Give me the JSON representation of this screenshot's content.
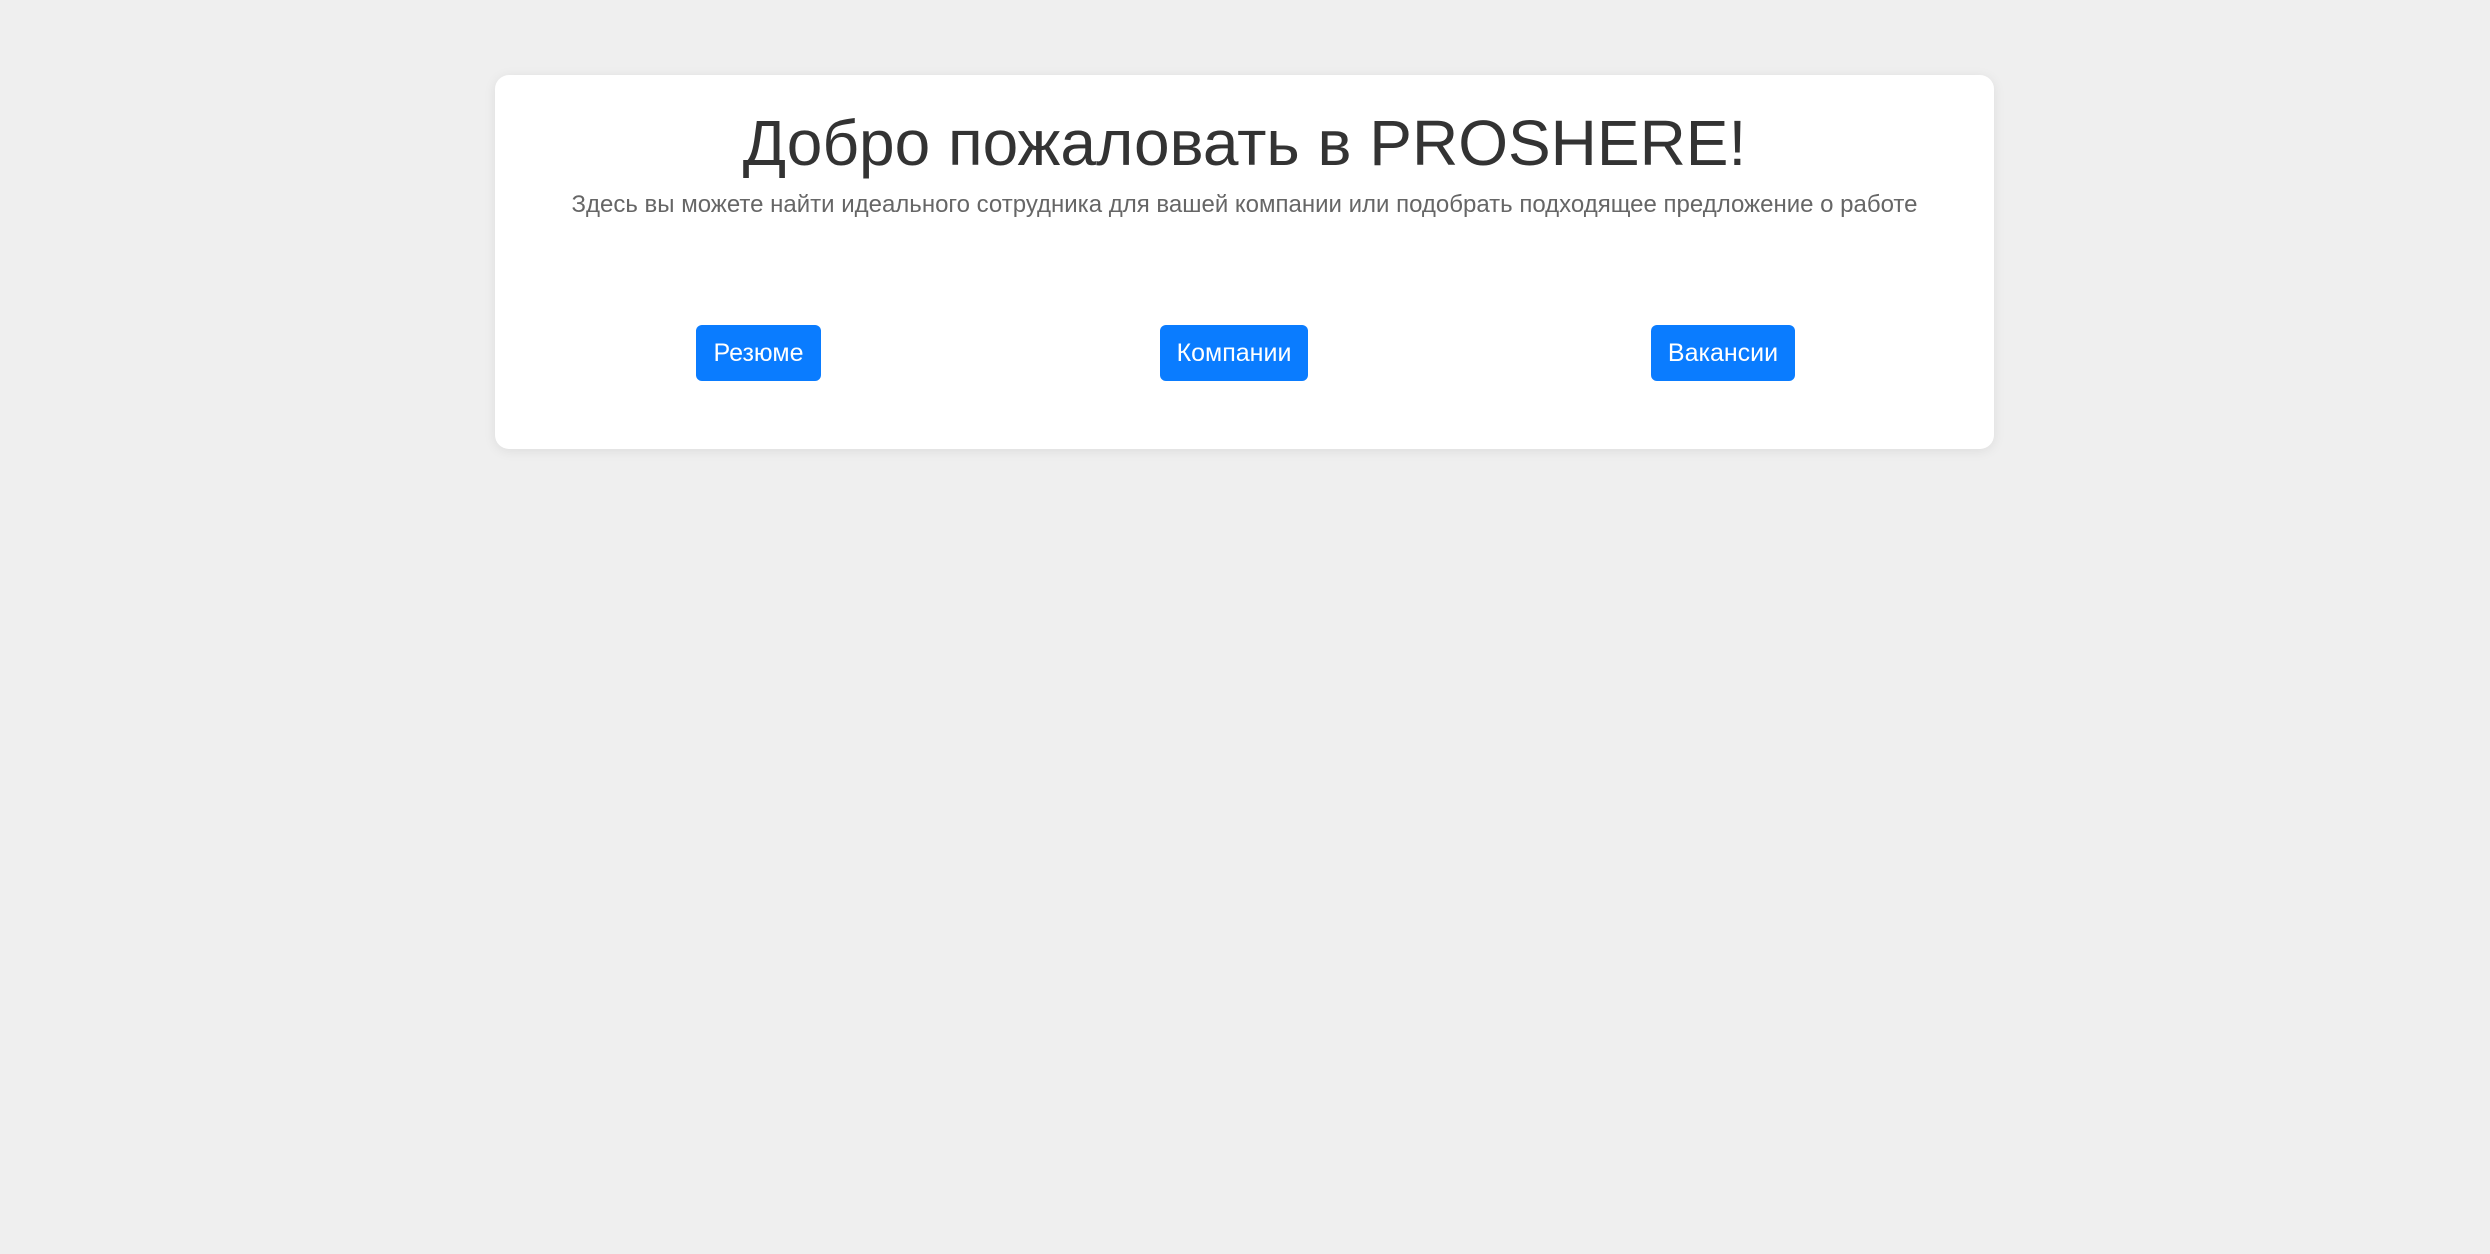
{
  "welcome": {
    "title": "Добро пожаловать в PROSHERE!",
    "subtitle": "Здесь вы можете найти идеального сотрудника для вашей компании или подобрать подходящее предложение о работе"
  },
  "nav_buttons": [
    {
      "label": "Резюме"
    },
    {
      "label": "Компании"
    },
    {
      "label": "Вакансии"
    }
  ],
  "colors": {
    "background": "#efefef",
    "card": "#ffffff",
    "accent": "#0a7cff",
    "title_text": "#333333",
    "subtitle_text": "#666666"
  }
}
